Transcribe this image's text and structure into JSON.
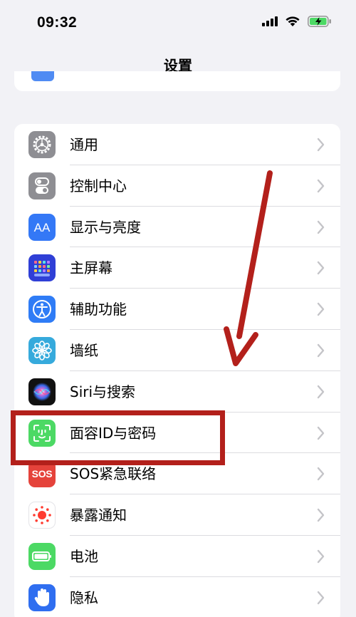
{
  "status_bar": {
    "time": "09:32"
  },
  "nav": {
    "title": "设置"
  },
  "settings_group": {
    "items": [
      {
        "id": "general",
        "label": "通用",
        "icon": "gear-icon",
        "color": "#8e8e93"
      },
      {
        "id": "control-center",
        "label": "控制中心",
        "icon": "toggle-switches-icon",
        "color": "#8e8e93"
      },
      {
        "id": "display",
        "label": "显示与亮度",
        "icon": "text-size-aa-icon",
        "color": "#3478f6"
      },
      {
        "id": "home-screen",
        "label": "主屏幕",
        "icon": "app-grid-icon",
        "color": "#2f3fd6"
      },
      {
        "id": "accessibility",
        "label": "辅助功能",
        "icon": "accessibility-person-icon",
        "color": "#2f7cf6"
      },
      {
        "id": "wallpaper",
        "label": "墙纸",
        "icon": "flower-icon",
        "color": "#36aadc"
      },
      {
        "id": "siri",
        "label": "Siri与搜索",
        "icon": "siri-orb-icon",
        "color": "#111111"
      },
      {
        "id": "face-id",
        "label": "面容ID与密码",
        "icon": "face-id-icon",
        "color": "#4cd964"
      },
      {
        "id": "sos",
        "label": "SOS紧急联络",
        "icon": "sos-icon",
        "color": "#e5433b",
        "icon_text": "SOS"
      },
      {
        "id": "exposure",
        "label": "暴露通知",
        "icon": "exposure-dots-icon",
        "color": "#ffffff"
      },
      {
        "id": "battery",
        "label": "电池",
        "icon": "battery-icon",
        "color": "#4cd964"
      },
      {
        "id": "privacy",
        "label": "隐私",
        "icon": "hand-icon",
        "color": "#2f6ef0"
      }
    ]
  },
  "annotation": {
    "color": "#b3201b",
    "highlighted_item": "face-id"
  }
}
